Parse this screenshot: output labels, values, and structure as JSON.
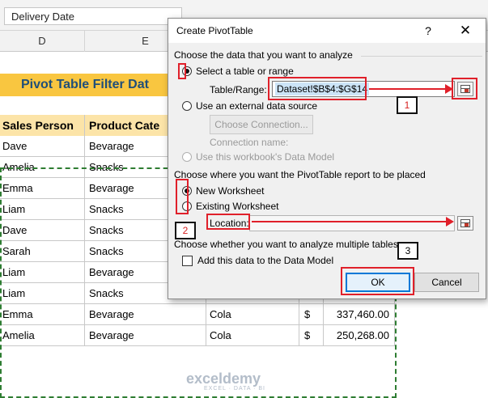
{
  "formula_bar": {
    "name_box": "Delivery Date"
  },
  "columns": [
    "D",
    "E"
  ],
  "sheet": {
    "title": "Pivot Table Filter Dat",
    "headers": [
      "Sales Person",
      "Product Cate"
    ],
    "rows": [
      {
        "person": "Dave",
        "product": "Bevarage",
        "item": "",
        "currency": "",
        "amount": ""
      },
      {
        "person": "Amelia",
        "product": "Snacks",
        "item": "",
        "currency": "",
        "amount": ""
      },
      {
        "person": "Emma",
        "product": "Bevarage",
        "item": "",
        "currency": "",
        "amount": ""
      },
      {
        "person": "Liam",
        "product": "Snacks",
        "item": "",
        "currency": "",
        "amount": ""
      },
      {
        "person": "Dave",
        "product": "Snacks",
        "item": "",
        "currency": "",
        "amount": ""
      },
      {
        "person": "Sarah",
        "product": "Snacks",
        "item": "",
        "currency": "",
        "amount": ""
      },
      {
        "person": "Liam",
        "product": "Bevarage",
        "item": "",
        "currency": "",
        "amount": ""
      },
      {
        "person": "Liam",
        "product": "Snacks",
        "item": "",
        "currency": "",
        "amount": ""
      },
      {
        "person": "Emma",
        "product": "Bevarage",
        "item": "Cola",
        "currency": "$",
        "amount": "337,460.00"
      },
      {
        "person": "Amelia",
        "product": "Bevarage",
        "item": "Cola",
        "currency": "$",
        "amount": "250,268.00"
      }
    ]
  },
  "watermark": {
    "logo": "exceldemy",
    "tagline": "EXCEL · DATA · BI"
  },
  "dialog": {
    "title": "Create PivotTable",
    "help": "?",
    "close": "✕",
    "section_source": "Choose the data that you want to analyze",
    "opt_select_table": "Select a table or range",
    "table_range_label": "Table/Range:",
    "table_range_value": "Dataset!$B$4:$G$14",
    "opt_external": "Use an external data source",
    "choose_connection": "Choose Connection...",
    "connection_name": "Connection name:",
    "opt_data_model": "Use this workbook's Data Model",
    "section_location": "Choose where you want the PivotTable report to be placed",
    "opt_new_ws": "New Worksheet",
    "opt_existing_ws": "Existing Worksheet",
    "location_label": "Location:",
    "location_value": "",
    "section_multi": "Choose whether you want to analyze multiple tables",
    "add_data_model": "Add this data to the Data Model",
    "ok": "OK",
    "cancel": "Cancel"
  },
  "annotations": {
    "n1": "1",
    "n2": "2",
    "n3": "3"
  },
  "colors": {
    "highlight": "#e0202a",
    "title_band": "#f9c640",
    "header_band": "#fce4a8",
    "ok_border": "#0078d7"
  }
}
